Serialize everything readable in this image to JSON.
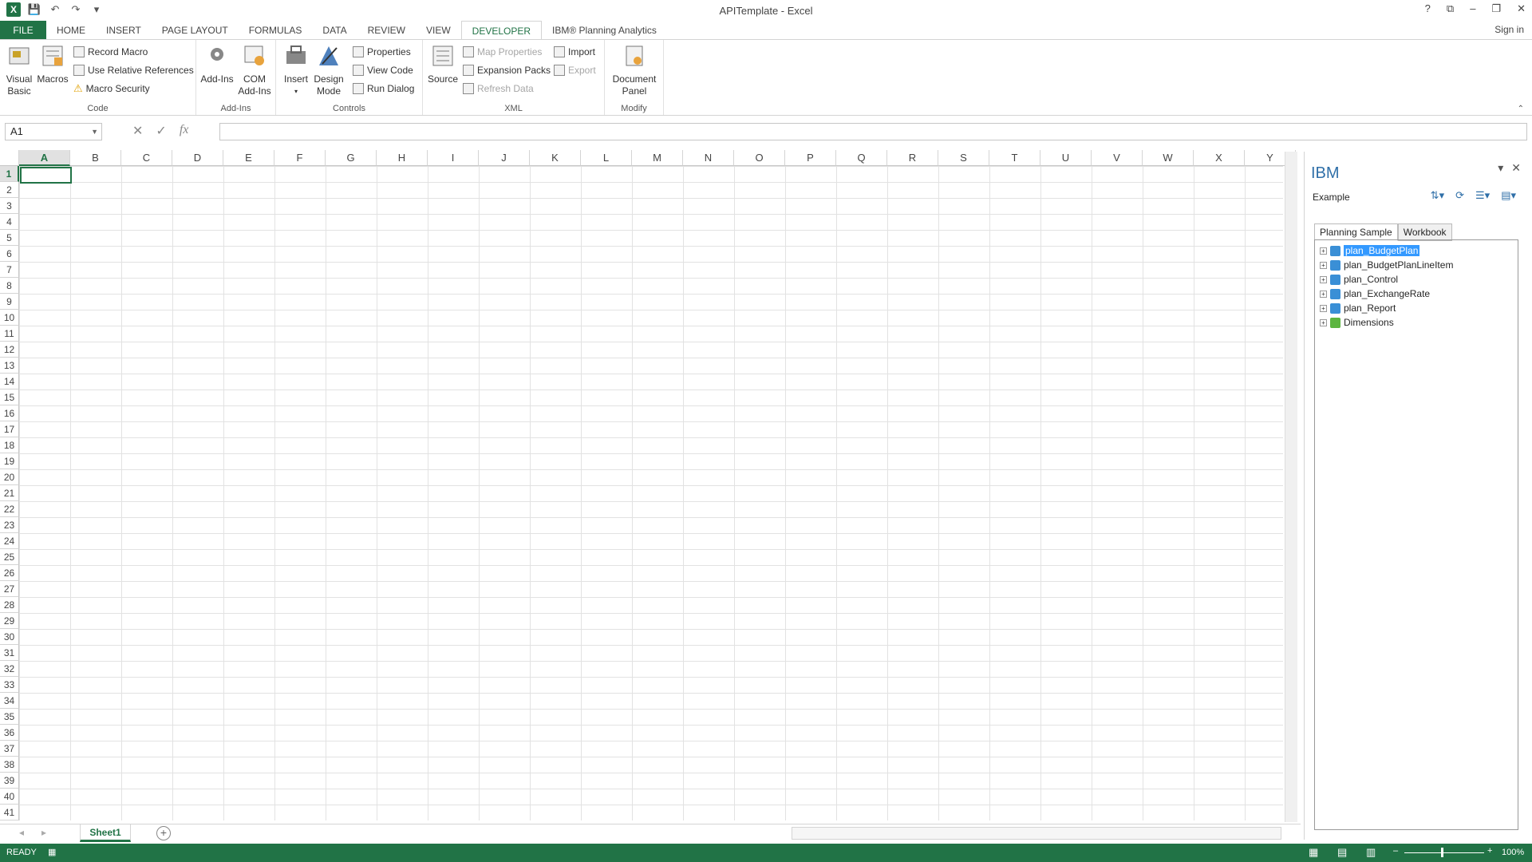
{
  "title_bar": {
    "app_title": "APITemplate - Excel",
    "controls": [
      "?",
      "⧉",
      "–",
      "❐",
      "✕"
    ]
  },
  "ribbon_tabs": [
    "FILE",
    "HOME",
    "INSERT",
    "PAGE LAYOUT",
    "FORMULAS",
    "DATA",
    "REVIEW",
    "VIEW",
    "DEVELOPER",
    "IBM® Planning Analytics"
  ],
  "active_tab": "DEVELOPER",
  "sign_in": "Sign in",
  "ribbon": {
    "code": {
      "label": "Code",
      "visual_basic": [
        "Visual",
        "Basic"
      ],
      "macros": "Macros",
      "record_macro": "Record Macro",
      "relative_refs": "Use Relative References",
      "macro_security": "Macro Security"
    },
    "addins": {
      "label": "Add-Ins",
      "addins": "Add-Ins",
      "com_addins": [
        "COM",
        "Add-Ins"
      ]
    },
    "controls": {
      "label": "Controls",
      "insert": "Insert",
      "design_mode": [
        "Design",
        "Mode"
      ],
      "properties": "Properties",
      "view_code": "View Code",
      "run_dialog": "Run Dialog"
    },
    "xml": {
      "label": "XML",
      "source": "Source",
      "map_properties": "Map Properties",
      "expansion_packs": "Expansion Packs",
      "refresh_data": "Refresh Data",
      "import": "Import",
      "export": "Export"
    },
    "modify": {
      "label": "Modify",
      "document_panel": [
        "Document",
        "Panel"
      ]
    }
  },
  "formula_bar": {
    "name_box": "A1",
    "fx": "fx",
    "value": ""
  },
  "columns": [
    "A",
    "B",
    "C",
    "D",
    "E",
    "F",
    "G",
    "H",
    "I",
    "J",
    "K",
    "L",
    "M",
    "N",
    "O",
    "P",
    "Q",
    "R",
    "S",
    "T",
    "U",
    "V",
    "W",
    "X",
    "Y"
  ],
  "rows": [
    "1",
    "2",
    "3",
    "4",
    "5",
    "6",
    "7",
    "8",
    "9",
    "10",
    "11",
    "12",
    "13",
    "14",
    "15",
    "16",
    "17",
    "18",
    "19",
    "20",
    "21",
    "22",
    "23",
    "24",
    "25",
    "26",
    "27",
    "28",
    "29",
    "30",
    "31",
    "32",
    "33",
    "34",
    "35",
    "36",
    "37",
    "38",
    "39",
    "40",
    "41"
  ],
  "sheet_tabs": [
    "Sheet1"
  ],
  "status": {
    "ready": "READY",
    "zoom": "100%"
  },
  "ibm_pane": {
    "title": "IBM",
    "server": "Example",
    "tabs": [
      "Planning Sample",
      "Workbook"
    ],
    "tree": [
      {
        "label": "plan_BudgetPlan",
        "type": "cube",
        "selected": true
      },
      {
        "label": "plan_BudgetPlanLineItem",
        "type": "cube"
      },
      {
        "label": "plan_Control",
        "type": "cube"
      },
      {
        "label": "plan_ExchangeRate",
        "type": "cube"
      },
      {
        "label": "plan_Report",
        "type": "cube"
      },
      {
        "label": "Dimensions",
        "type": "dimensions"
      }
    ]
  }
}
